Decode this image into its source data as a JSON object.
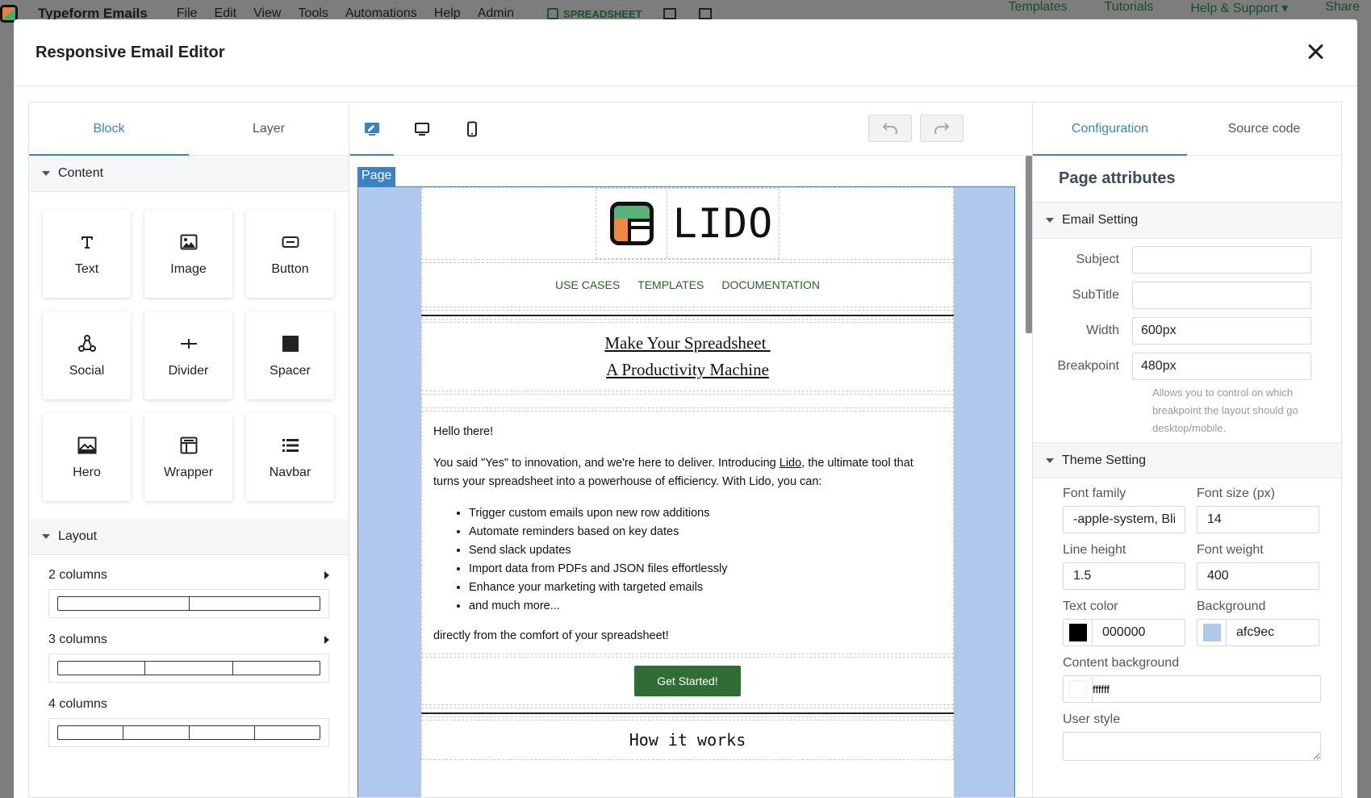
{
  "app": {
    "brand": "Typeform Emails",
    "menu": [
      "File",
      "Edit",
      "View",
      "Tools",
      "Automations",
      "Help",
      "Admin"
    ],
    "spreadsheet_label": "SPREADSHEET",
    "right_links": [
      "Templates",
      "Tutorials",
      "Help & Support ▾",
      "Share"
    ]
  },
  "modal": {
    "title": "Responsive Email Editor"
  },
  "left": {
    "tabs": [
      "Block",
      "Layer"
    ],
    "content_section": "Content",
    "blocks": [
      {
        "label": "Text",
        "icon": "text-icon"
      },
      {
        "label": "Image",
        "icon": "image-icon"
      },
      {
        "label": "Button",
        "icon": "button-icon"
      },
      {
        "label": "Social",
        "icon": "social-icon"
      },
      {
        "label": "Divider",
        "icon": "divider-icon"
      },
      {
        "label": "Spacer",
        "icon": "spacer-icon"
      },
      {
        "label": "Hero",
        "icon": "hero-icon"
      },
      {
        "label": "Wrapper",
        "icon": "wrapper-icon"
      },
      {
        "label": "Navbar",
        "icon": "navbar-icon"
      }
    ],
    "layout_section": "Layout",
    "layouts": [
      "2 columns",
      "3 columns",
      "4 columns"
    ]
  },
  "center": {
    "page_label": "Page",
    "email": {
      "logo_text": "LIDO",
      "nav": [
        "USE CASES",
        "TEMPLATES",
        "DOCUMENTATION"
      ],
      "heading_line1": "Make Your Spreadsheet ",
      "heading_line2": "A Productivity Machine",
      "greeting": "Hello there!",
      "intro_before": "You said \"Yes\" to innovation, and we're here to deliver. Introducing ",
      "intro_link": "Lido",
      "intro_after": ", the ultimate tool that turns your spreadsheet into a powerhouse of efficiency. With Lido, you can:",
      "bullets": [
        "Trigger custom emails upon new row additions",
        "Automate reminders based on key dates",
        "Send slack updates",
        "Import data from PDFs and JSON files effortlessly",
        "Enhance your marketing with targeted emails",
        "and much more..."
      ],
      "closing": "directly from the comfort of your spreadsheet!",
      "cta": "Get Started!",
      "how_heading": "How it works"
    }
  },
  "right": {
    "tabs": [
      "Configuration",
      "Source code"
    ],
    "title": "Page attributes",
    "email_setting": "Email Setting",
    "fields": {
      "subject_label": "Subject",
      "subject_value": "",
      "subtitle_label": "SubTitle",
      "subtitle_value": "",
      "width_label": "Width",
      "width_value": "600px",
      "breakpoint_label": "Breakpoint",
      "breakpoint_value": "480px",
      "breakpoint_hint": "Allows you to control on which breakpoint the layout should go desktop/mobile."
    },
    "theme_setting": "Theme Setting",
    "theme": {
      "font_family_label": "Font family",
      "font_family_value": "-apple-system, BlinkMacSystemFont",
      "font_size_label": "Font size (px)",
      "font_size_value": "14",
      "line_height_label": "Line height",
      "line_height_value": "1.5",
      "font_weight_label": "Font weight",
      "font_weight_value": "400",
      "text_color_label": "Text color",
      "text_color_value": "000000",
      "background_label": "Background",
      "background_value": "afc9ec",
      "content_bg_label": "Content background",
      "content_bg_value": "ffffff",
      "user_style_label": "User style"
    },
    "colors": {
      "text": "#000000",
      "background": "#afc9ec",
      "content": "#ffffff"
    }
  }
}
